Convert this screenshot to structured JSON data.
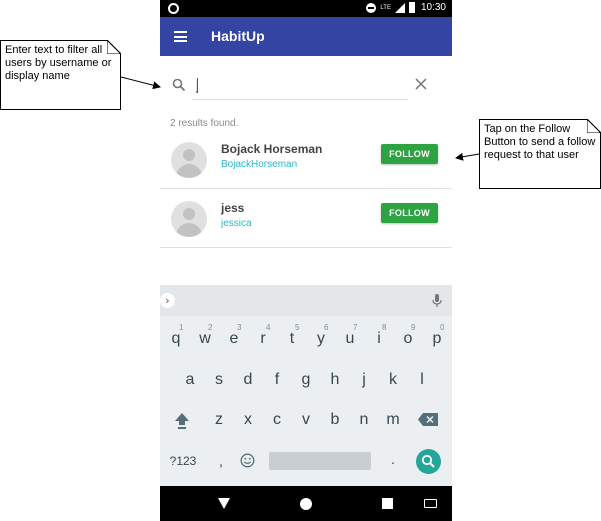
{
  "statusbar": {
    "time": "10:30",
    "network": "LTE"
  },
  "appbar": {
    "title": "HabitUp"
  },
  "search": {
    "value": "j",
    "placeholder": ""
  },
  "results": {
    "count_text": "2 results found.",
    "users": [
      {
        "display_name": "Bojack Horseman",
        "username": "BojackHorseman",
        "button_label": "FOLLOW"
      },
      {
        "display_name": "jess",
        "username": "jessica",
        "button_label": "FOLLOW"
      }
    ]
  },
  "keyboard": {
    "row1": [
      "q",
      "w",
      "e",
      "r",
      "t",
      "y",
      "u",
      "i",
      "o",
      "p"
    ],
    "row1_hints": [
      "1",
      "2",
      "3",
      "4",
      "5",
      "6",
      "7",
      "8",
      "9",
      "0"
    ],
    "row2": [
      "a",
      "s",
      "d",
      "f",
      "g",
      "h",
      "j",
      "k",
      "l"
    ],
    "row3": [
      "z",
      "x",
      "c",
      "v",
      "b",
      "n",
      "m"
    ],
    "symbols_label": "?123",
    "comma": ",",
    "period": "."
  },
  "annotations": {
    "search_note": "Enter text to filter all users by username or display name",
    "follow_note": "Tap on the Follow Button to send a follow request to that user"
  },
  "colors": {
    "appbar": "#3344a3",
    "follow_button": "#2ea342",
    "username": "#29b6c6",
    "keyboard_search": "#26a69a"
  }
}
